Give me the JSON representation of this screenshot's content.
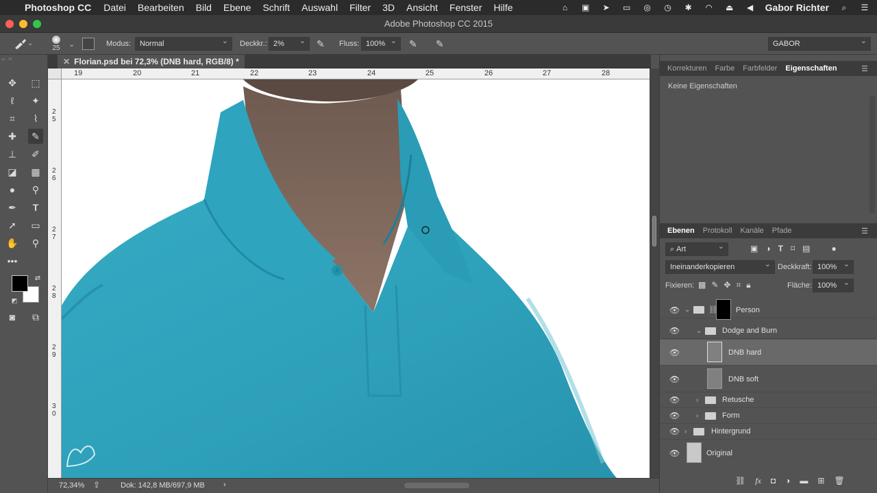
{
  "menubar": {
    "app": "Photoshop CC",
    "items": [
      "Datei",
      "Bearbeiten",
      "Bild",
      "Ebene",
      "Schrift",
      "Auswahl",
      "Filter",
      "3D",
      "Ansicht",
      "Fenster",
      "Hilfe"
    ],
    "user": "Gabor Richter"
  },
  "window": {
    "title": "Adobe Photoshop CC 2015"
  },
  "options": {
    "brush_size": "25",
    "mode_label": "Modus:",
    "mode_value": "Normal",
    "opacity_label": "Deckkr.:",
    "opacity_value": "2%",
    "flow_label": "Fluss:",
    "flow_value": "100%",
    "workspace": "GABOR"
  },
  "document": {
    "tab_title": "Florian.psd bei 72,3% (DNB hard, RGB/8) *",
    "ruler_h": [
      "19",
      "20",
      "21",
      "22",
      "23",
      "24",
      "25",
      "26",
      "27",
      "28"
    ],
    "ruler_v": [
      "2\n5",
      "2\n6",
      "2\n7",
      "2\n8",
      "2\n9",
      "3\n0"
    ]
  },
  "status": {
    "zoom": "72,34%",
    "doc": "Dok: 142,8 MB/697,9 MB"
  },
  "properties_panel": {
    "tabs": [
      "Korrekturen",
      "Farbe",
      "Farbfelder",
      "Eigenschaften"
    ],
    "active_tab": "Eigenschaften",
    "empty_text": "Keine Eigenschaften"
  },
  "layers_panel": {
    "tabs": [
      "Ebenen",
      "Protokoll",
      "Kanäle",
      "Pfade"
    ],
    "active_tab": "Ebenen",
    "filter_value": "Art",
    "blend_mode": "Ineinanderkopieren",
    "opacity_label": "Deckkraft:",
    "opacity_value": "100%",
    "lock_label": "Fixieren:",
    "fill_label": "Fläche:",
    "fill_value": "100%",
    "layers": [
      {
        "name": "Person"
      },
      {
        "name": "Dodge and Burn"
      },
      {
        "name": "DNB hard"
      },
      {
        "name": "DNB soft"
      },
      {
        "name": "Retusche"
      },
      {
        "name": "Form"
      },
      {
        "name": "Hintergrund"
      },
      {
        "name": "Original"
      }
    ],
    "selected_layer": "DNB hard"
  },
  "colors": {
    "shirt": "#2fa6c0",
    "shirt_shadow": "#1e8ba4",
    "skin": "#8a6f60",
    "foreground": "#000000",
    "background": "#ffffff"
  }
}
